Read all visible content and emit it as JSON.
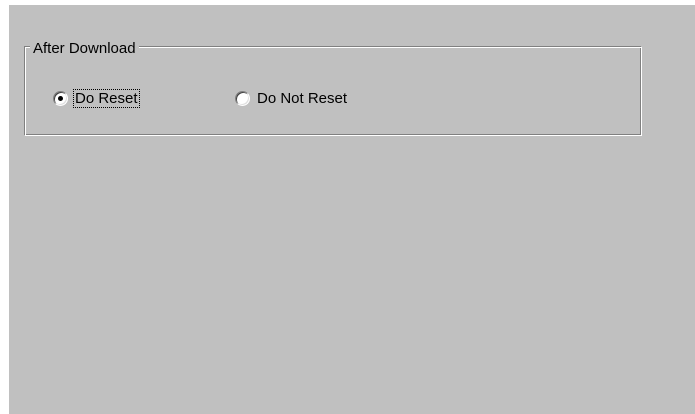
{
  "group": {
    "title": "After Download",
    "options": [
      {
        "label": "Do Reset",
        "checked": true,
        "focused": true
      },
      {
        "label": "Do Not Reset",
        "checked": false,
        "focused": false
      }
    ]
  },
  "colors": {
    "dialog_bg": "#c0c0c0",
    "text": "#000000"
  }
}
